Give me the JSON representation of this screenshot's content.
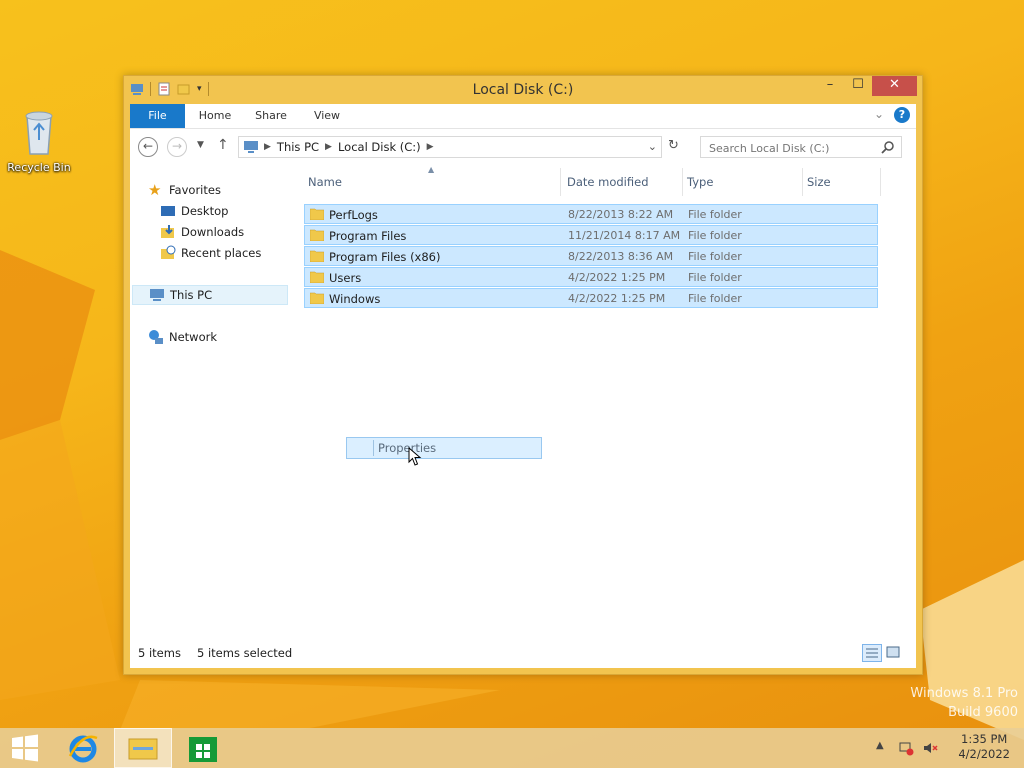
{
  "desktop": {
    "recycle_bin_label": "Recycle Bin",
    "watermark_line1": "Windows 8.1 Pro",
    "watermark_line2": "Build 9600"
  },
  "window": {
    "title": "Local Disk (C:)",
    "controls": {
      "minimize": "–",
      "maximize": "☐",
      "close": "✕"
    }
  },
  "ribbon": {
    "tabs": [
      {
        "label": "File"
      },
      {
        "label": "Home"
      },
      {
        "label": "Share"
      },
      {
        "label": "View"
      }
    ]
  },
  "address": {
    "crumbs": [
      "This PC",
      "Local Disk (C:)"
    ],
    "search_placeholder": "Search Local Disk (C:)"
  },
  "nav": {
    "favorites": "Favorites",
    "desktop": "Desktop",
    "downloads": "Downloads",
    "recent": "Recent places",
    "this_pc": "This PC",
    "network": "Network"
  },
  "columns": [
    "Name",
    "Date modified",
    "Type",
    "Size"
  ],
  "files": [
    {
      "name": "PerfLogs",
      "date": "8/22/2013 8:22 AM",
      "type": "File folder"
    },
    {
      "name": "Program Files",
      "date": "11/21/2014 8:17 AM",
      "type": "File folder"
    },
    {
      "name": "Program Files (x86)",
      "date": "8/22/2013 8:36 AM",
      "type": "File folder"
    },
    {
      "name": "Users",
      "date": "4/2/2022 1:25 PM",
      "type": "File folder"
    },
    {
      "name": "Windows",
      "date": "4/2/2022 1:25 PM",
      "type": "File folder"
    }
  ],
  "drag_ghost": {
    "label": "Properties"
  },
  "status": {
    "items": "5 items",
    "selected": "5 items selected"
  },
  "taskbar": {
    "time": "1:35 PM",
    "date": "4/2/2022"
  },
  "colors": {
    "accent": "#1979ca",
    "selection": "#cce8ff",
    "selection_border": "#99d1ff",
    "title_bg": "#f2c44f",
    "close": "#c7504a"
  }
}
